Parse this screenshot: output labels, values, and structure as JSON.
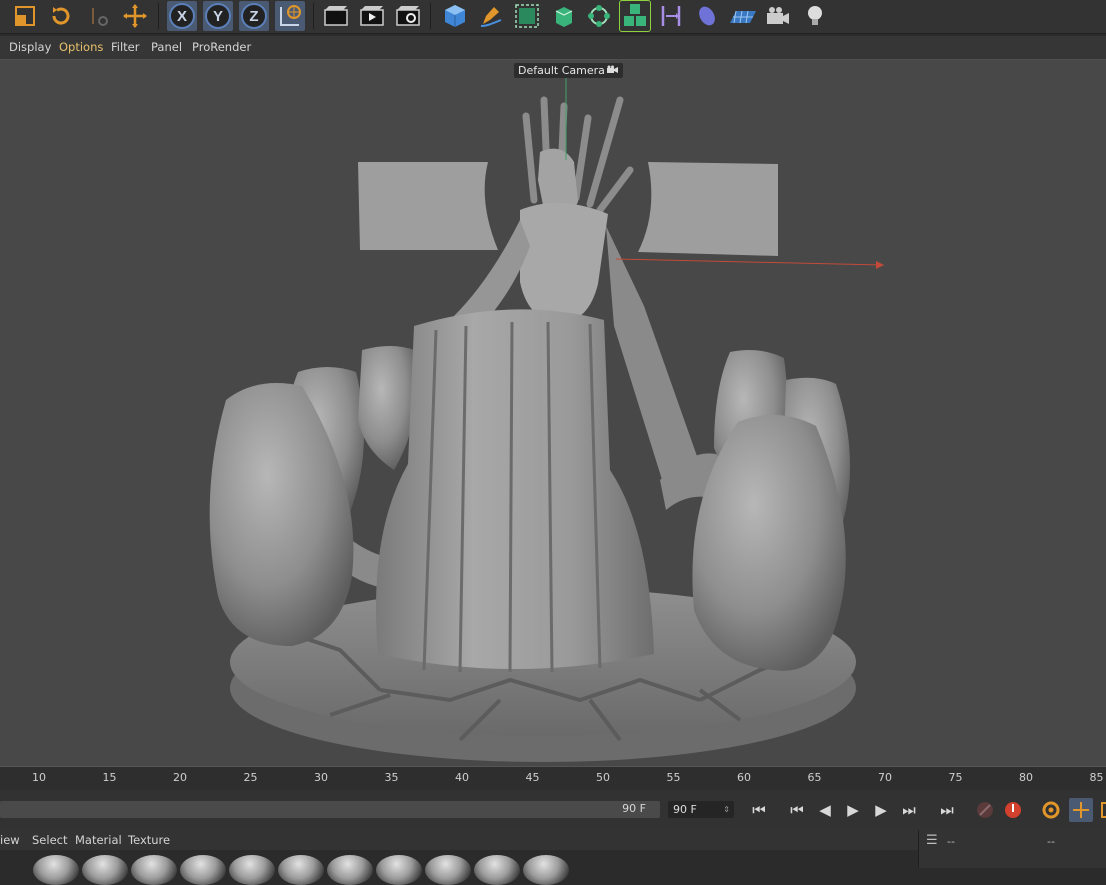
{
  "toolbar": {
    "icons": [
      "scale-icon",
      "rotate-icon",
      "recent-tools-icon",
      "move-icon",
      "x-axis-icon",
      "y-axis-icon",
      "z-axis-icon",
      "world-coordinates-icon",
      "render-region-icon",
      "render-view-icon",
      "render-settings-icon",
      "cube-icon",
      "pen-icon",
      "subdivision-icon",
      "extrude-icon",
      "cloner-icon",
      "mograph-icon",
      "deformer-icon",
      "field-icon",
      "floor-icon",
      "camera-icon",
      "light-icon"
    ],
    "axis_x": "X",
    "axis_y": "Y",
    "axis_z": "Z"
  },
  "viewport_menu": {
    "display": "Display",
    "options": "Options",
    "filter": "Filter",
    "panel": "Panel",
    "prorender": "ProRender"
  },
  "viewport": {
    "camera_label": "Default Camera",
    "background": "#484848"
  },
  "timeline": {
    "ticks": [
      "10",
      "15",
      "20",
      "25",
      "30",
      "35",
      "40",
      "45",
      "50",
      "55",
      "60",
      "65",
      "70",
      "75",
      "80",
      "85"
    ],
    "range_end": "90 F",
    "current_frame": "90 F"
  },
  "material_menu": {
    "view": "iew",
    "select": "Select",
    "material": "Material",
    "texture": "Texture"
  },
  "attributes": {
    "header_a": "--",
    "header_b": "--"
  },
  "colors": {
    "accent_orange": "#e0962a",
    "axis_blue": "#5b7fb8",
    "active_menu": "#e7c16b",
    "selection_green": "#8fd13f"
  }
}
